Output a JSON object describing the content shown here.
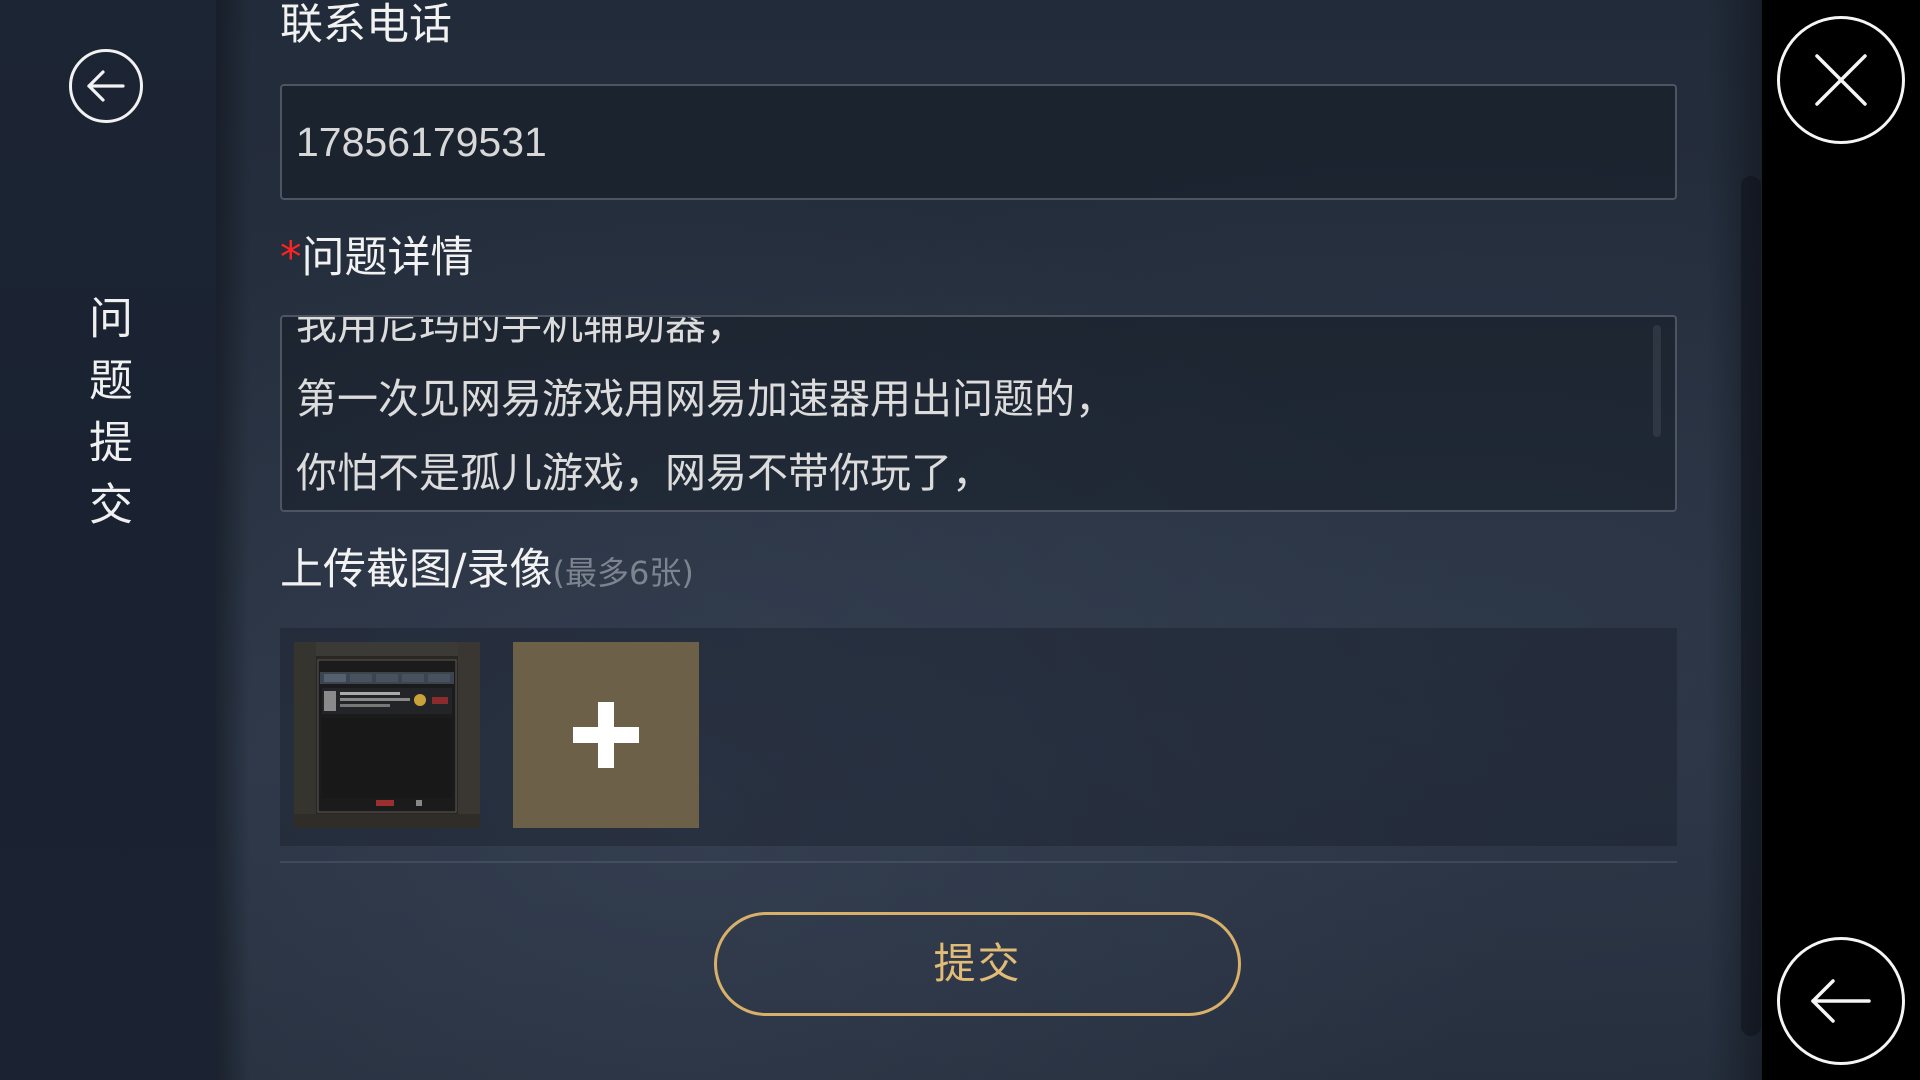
{
  "sidebar": {
    "title": "问题提交",
    "back_icon": "arrow-left-circle-icon"
  },
  "form": {
    "phone_label": "联系电话",
    "phone_value": "17856179531",
    "detail_required_mark": "*",
    "detail_label": "问题详情",
    "detail_lines": [
      "我用尼玛的手机辅助器，",
      "第一次见网易游戏用网易加速器用出问题的，",
      "你怕不是孤儿游戏，网易不带你玩了，"
    ],
    "upload_label": "上传截图/录像",
    "upload_hint": "(最多6张)",
    "add_icon": "plus-icon",
    "submit_label": "提交"
  },
  "rail": {
    "close_icon": "close-icon",
    "back_icon": "arrow-left-icon"
  },
  "colors": {
    "accent": "#d9b06a",
    "required": "#ff2323",
    "add_tile": "#6d6048"
  }
}
